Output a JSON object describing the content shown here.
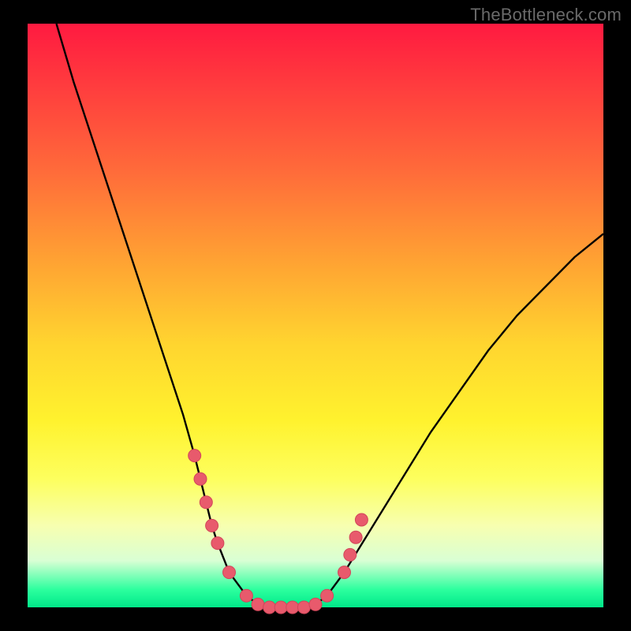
{
  "watermark": "TheBottleneck.com",
  "colors": {
    "frame": "#000000",
    "curve": "#000000",
    "marker_fill": "#e85a6c",
    "marker_stroke": "#d2465a"
  },
  "chart_data": {
    "type": "line",
    "title": "",
    "xlabel": "",
    "ylabel": "",
    "xlim": [
      0,
      100
    ],
    "ylim": [
      0,
      100
    ],
    "series": [
      {
        "name": "bottleneck-curve",
        "x": [
          5,
          8,
          12,
          16,
          20,
          24,
          27,
          29,
          30,
          31,
          32,
          33,
          35,
          38,
          40,
          42,
          44,
          46,
          48,
          50,
          52,
          55,
          60,
          65,
          70,
          75,
          80,
          85,
          90,
          95,
          100
        ],
        "y": [
          100,
          90,
          78,
          66,
          54,
          42,
          33,
          26,
          22,
          18,
          14,
          11,
          6,
          2,
          0.5,
          0,
          0,
          0,
          0,
          0.5,
          2,
          6,
          14,
          22,
          30,
          37,
          44,
          50,
          55,
          60,
          64
        ]
      }
    ],
    "markers": {
      "name": "highlight-points",
      "x": [
        29,
        30,
        31,
        32,
        33,
        35,
        38,
        40,
        42,
        44,
        46,
        48,
        50,
        52,
        55,
        56,
        57,
        58
      ],
      "y": [
        26,
        22,
        18,
        14,
        11,
        6,
        2,
        0.5,
        0,
        0,
        0,
        0,
        0.5,
        2,
        6,
        9,
        12,
        15
      ]
    },
    "gradient_stops": [
      {
        "pos": 0,
        "color": "#ff1a40"
      },
      {
        "pos": 25,
        "color": "#ff6a3a"
      },
      {
        "pos": 55,
        "color": "#ffd52f"
      },
      {
        "pos": 78,
        "color": "#fdff5e"
      },
      {
        "pos": 92,
        "color": "#d9ffd4"
      },
      {
        "pos": 100,
        "color": "#00e889"
      }
    ]
  }
}
